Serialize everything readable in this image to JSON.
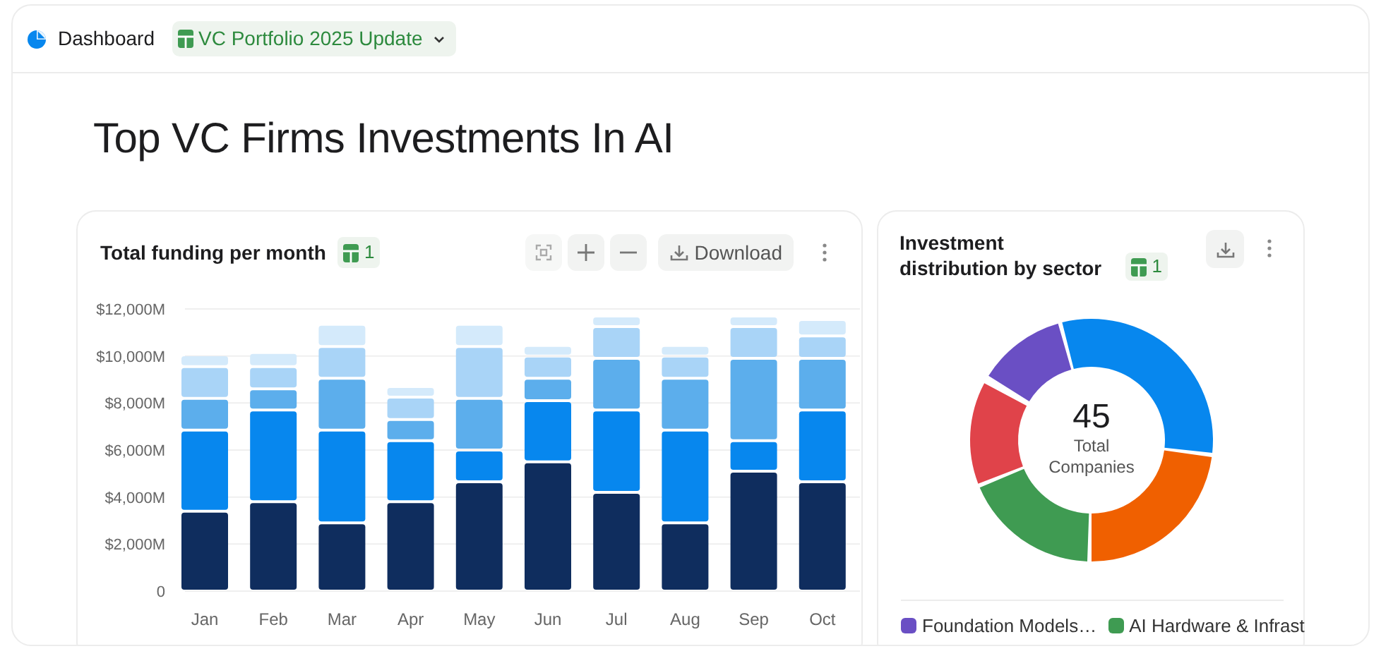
{
  "header": {
    "title": "Dashboard",
    "document": {
      "label": "VC Portfolio 2025 Update"
    }
  },
  "page_title": "Top VC Firms Investments In AI",
  "funding_card": {
    "title": "Total funding per month",
    "source_count": "1",
    "download_label": "Download",
    "chart_data": {
      "type": "bar",
      "stacked": true,
      "grid": true,
      "categories": [
        "Jan",
        "Feb",
        "Mar",
        "Apr",
        "May",
        "Jun",
        "Jul",
        "Aug",
        "Sep",
        "Oct"
      ],
      "ylim": [
        0,
        12000
      ],
      "yticks": [
        {
          "value": 0,
          "label": "0"
        },
        {
          "value": 2000,
          "label": "$2,000M"
        },
        {
          "value": 4000,
          "label": "$4,000M"
        },
        {
          "value": 6000,
          "label": "$6,000M"
        },
        {
          "value": 8000,
          "label": "$8,000M"
        },
        {
          "value": 10000,
          "label": "$10,000M"
        },
        {
          "value": 12000,
          "label": "$12,000M"
        }
      ],
      "series": [
        {
          "color": "#0f2d5e",
          "values": [
            3400,
            3800,
            2900,
            3800,
            4650,
            5500,
            4200,
            2900,
            5100,
            4650
          ]
        },
        {
          "color": "#0787ee",
          "values": [
            3450,
            3900,
            3950,
            2600,
            1350,
            2600,
            3500,
            3950,
            1300,
            3050
          ]
        },
        {
          "color": "#5caeec",
          "values": [
            1350,
            900,
            2200,
            900,
            2200,
            950,
            2200,
            2200,
            3500,
            2200
          ]
        },
        {
          "color": "#a9d4f7",
          "values": [
            1350,
            950,
            1350,
            950,
            2200,
            950,
            1350,
            950,
            1350,
            950
          ]
        },
        {
          "color": "#d4eafb",
          "values": [
            500,
            600,
            950,
            450,
            950,
            450,
            450,
            450,
            450,
            700
          ]
        }
      ]
    }
  },
  "distribution_card": {
    "title": "Investment distribution by sector",
    "source_count": "1",
    "center_value": "45",
    "center_label": "Total Companies",
    "legend": [
      {
        "label": "Foundation Models…",
        "color": "#6a4fc4"
      },
      {
        "label": "AI Hardware & Infrast",
        "color": "#3f9b52"
      }
    ]
  }
}
